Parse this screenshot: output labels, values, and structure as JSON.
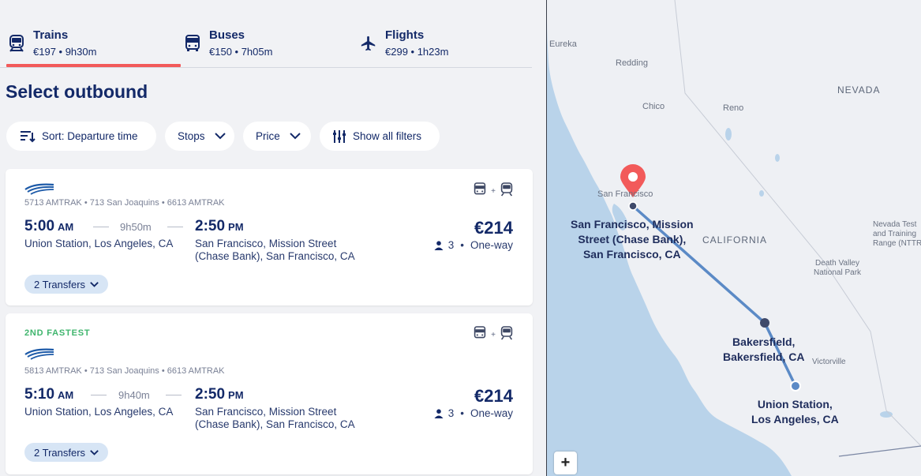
{
  "tabs": [
    {
      "title": "Trains",
      "sub": "€197 • 9h30m",
      "icon": "train-icon"
    },
    {
      "title": "Buses",
      "sub": "€150 • 7h05m",
      "icon": "bus-icon"
    },
    {
      "title": "Flights",
      "sub": "€299 • 1h23m",
      "icon": "plane-icon"
    }
  ],
  "heading": "Select outbound",
  "filters": {
    "sort": "Sort: Departure time",
    "stops": "Stops",
    "price": "Price",
    "all": "Show all filters"
  },
  "results": [
    {
      "badge": "",
      "trains": "5713 AMTRAK • 713 San Joaquins • 6613 AMTRAK",
      "dep_time": "5:00",
      "dep_ampm": "AM",
      "duration": "9h50m",
      "arr_time": "2:50",
      "arr_ampm": "PM",
      "origin": "Union Station, Los Angeles, CA",
      "dest_line1": "San Francisco, Mission Street",
      "dest_line2": "(Chase Bank), San Francisco, CA",
      "price": "€214",
      "passengers": "3",
      "trip_type": "One-way",
      "transfers": "2 Transfers"
    },
    {
      "badge": "2ND FASTEST",
      "trains": "5813 AMTRAK • 713 San Joaquins • 6613 AMTRAK",
      "dep_time": "5:10",
      "dep_ampm": "AM",
      "duration": "9h40m",
      "arr_time": "2:50",
      "arr_ampm": "PM",
      "origin": "Union Station, Los Angeles, CA",
      "dest_line1": "San Francisco, Mission Street",
      "dest_line2": "(Chase Bank), San Francisco, CA",
      "price": "€214",
      "passengers": "3",
      "trip_type": "One-way",
      "transfers": "2 Transfers"
    }
  ],
  "map": {
    "places": {
      "eureka": "Eureka",
      "redding": "Redding",
      "chico": "Chico",
      "reno": "Reno",
      "nevada": "NEVADA",
      "san_francisco": "San Francisco",
      "california": "CALIFORNIA",
      "nevada_test1": "Nevada Test",
      "nevada_test2": "and Training",
      "nevada_test3": "Range (NTTR",
      "death_valley1": "Death Valley",
      "death_valley2": "National Park",
      "victorville": "Victorville"
    },
    "stations": {
      "sf1": "San Francisco, Mission",
      "sf2": "Street (Chase Bank),",
      "sf3": "San Francisco, CA",
      "bak1": "Bakersfield,",
      "bak2": "Bakersfield, CA",
      "la1": "Union Station,",
      "la2": "Los Angeles, CA"
    },
    "zoom_in": "+"
  },
  "colors": {
    "accent": "#f25a5a",
    "navy": "#132968",
    "green": "#3fb56d",
    "route": "#5b8ac6",
    "water": "#b9d3ea",
    "land": "#eef0f4"
  }
}
